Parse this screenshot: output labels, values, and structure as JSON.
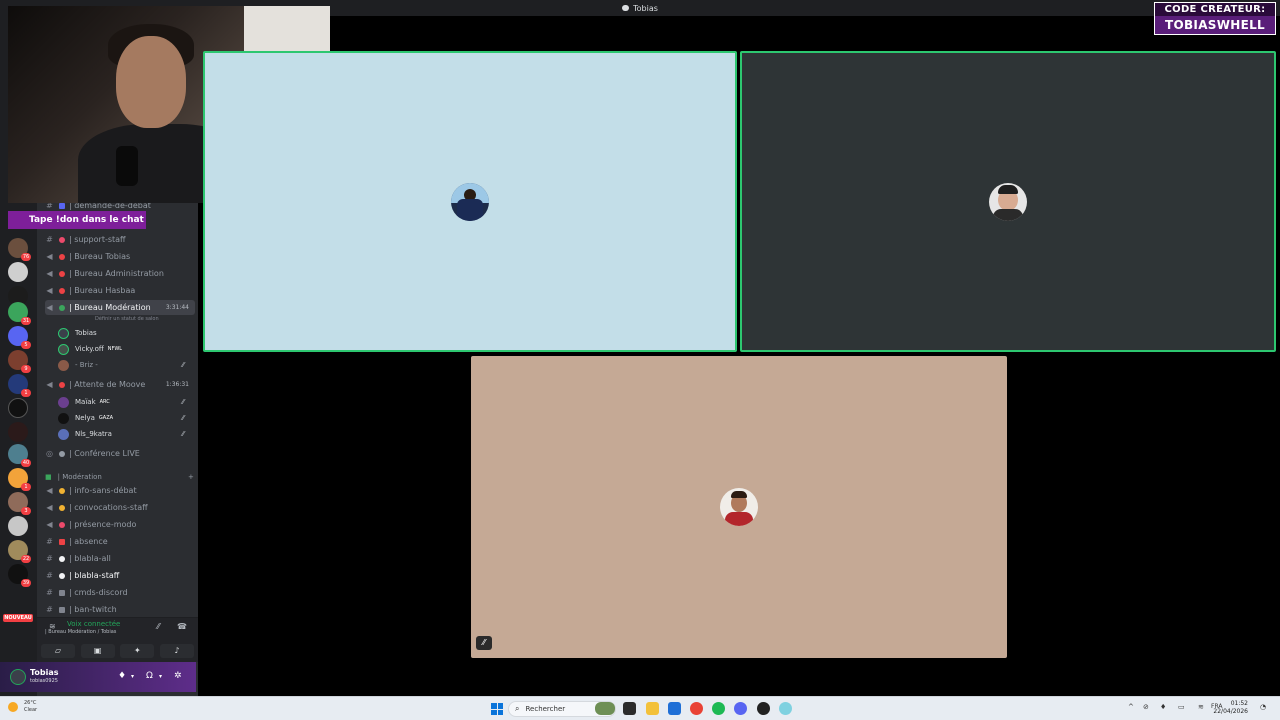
{
  "window": {
    "title": "Tobias"
  },
  "promo": {
    "line1": "CODE CREATEUR:",
    "line2": "TOBIASWHELL"
  },
  "banner": {
    "text": "Tape !don dans le chat"
  },
  "servers": {
    "badges": [
      "76",
      "8",
      "31",
      "5",
      "9",
      "1",
      "40",
      "1",
      "3",
      "22",
      "39"
    ],
    "new_label": "NOUVEAU"
  },
  "channels": {
    "items": [
      {
        "label": "| demande-de-débat"
      },
      {
        "label": "| support-staff"
      },
      {
        "label": "| Bureau Tobias"
      },
      {
        "label": "| Bureau Administration"
      },
      {
        "label": "| Bureau Hasbaa"
      },
      {
        "label": "| Bureau Modération",
        "timer": "3:31:44",
        "status": "Définir un statut de salon"
      },
      {
        "label": "| Attente de Moove",
        "timer": "1:36:31"
      },
      {
        "label": "| Conférence LIVE"
      },
      {
        "label": "| info-sans-débat"
      },
      {
        "label": "| convocations-staff"
      },
      {
        "label": "| présence-modo"
      },
      {
        "label": "| absence"
      },
      {
        "label": "| blabla-all"
      },
      {
        "label": "| blabla-staff"
      },
      {
        "label": "| cmds-discord"
      },
      {
        "label": "| ban-twitch"
      }
    ],
    "category": "| Modération",
    "voice_users_moderation": [
      {
        "name": "Tobias"
      },
      {
        "name": "Vicky.off",
        "tag": "NFWL"
      },
      {
        "name": "- Briz -"
      }
    ],
    "voice_users_attente": [
      {
        "name": "Maïak",
        "tag": "ARC"
      },
      {
        "name": "Nelya",
        "tag": "GAZA"
      },
      {
        "name": "Nls_9katra"
      }
    ]
  },
  "voice_panel": {
    "status": "Voix connectée",
    "location": "| Bureau Modération / Tobias"
  },
  "user_panel": {
    "name": "Tobias",
    "handle": "tobias0925"
  },
  "taskbar": {
    "weather_temp": "26°C",
    "weather_desc": "Clear",
    "search_placeholder": "Rechercher",
    "lang": "FRA",
    "time": "01:52",
    "date": "22/04/2026"
  },
  "colors": {
    "speaking": "#2dc770",
    "tile1_bg": "#c3dee8",
    "tile2_bg": "#2e3436",
    "tile3_bg": "#c5a995",
    "banner": "#7e1f9a"
  }
}
